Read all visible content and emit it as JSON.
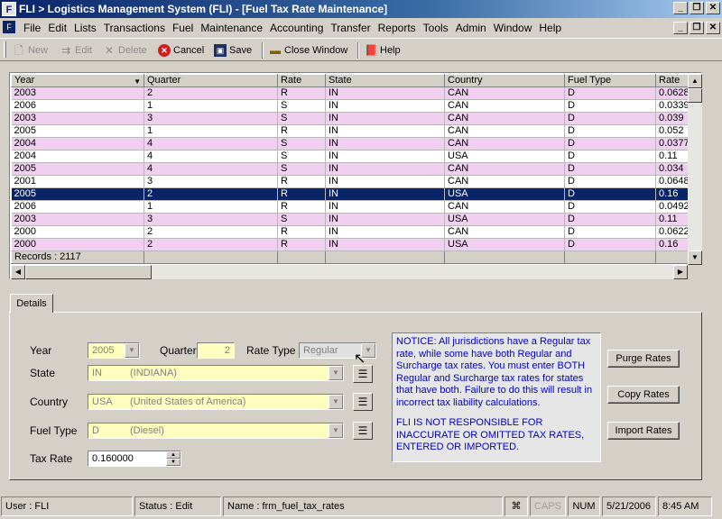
{
  "window": {
    "title": "FLI > Logistics Management System (FLI) - [Fuel Tax Rate Maintenance]",
    "app_icon": "FLI-logo"
  },
  "menu": [
    "File",
    "Edit",
    "Lists",
    "Transactions",
    "Fuel",
    "Maintenance",
    "Accounting",
    "Transfer",
    "Reports",
    "Tools",
    "Admin",
    "Window",
    "Help"
  ],
  "toolbar": {
    "new_label": "New",
    "edit_label": "Edit",
    "delete_label": "Delete",
    "cancel_label": "Cancel",
    "save_label": "Save",
    "close_label": "Close Window",
    "help_label": "Help"
  },
  "grid": {
    "columns": [
      "Year",
      "Quarter",
      "Rate",
      "State",
      "Country",
      "Fuel Type",
      "Rate"
    ],
    "rows": [
      [
        "2003",
        "2",
        "R",
        "IN",
        "CAN",
        "D",
        "0.0628"
      ],
      [
        "2006",
        "1",
        "S",
        "IN",
        "CAN",
        "D",
        "0.0339"
      ],
      [
        "2003",
        "3",
        "S",
        "IN",
        "CAN",
        "D",
        "0.039"
      ],
      [
        "2005",
        "1",
        "R",
        "IN",
        "CAN",
        "D",
        "0.052"
      ],
      [
        "2004",
        "4",
        "S",
        "IN",
        "CAN",
        "D",
        "0.0377"
      ],
      [
        "2004",
        "4",
        "S",
        "IN",
        "USA",
        "D",
        "0.11"
      ],
      [
        "2005",
        "4",
        "S",
        "IN",
        "CAN",
        "D",
        "0.034"
      ],
      [
        "2001",
        "3",
        "R",
        "IN",
        "CAN",
        "D",
        "0.0648"
      ],
      [
        "2005",
        "2",
        "R",
        "IN",
        "USA",
        "D",
        "0.16"
      ],
      [
        "2006",
        "1",
        "R",
        "IN",
        "CAN",
        "D",
        "0.0492"
      ],
      [
        "2003",
        "3",
        "S",
        "IN",
        "USA",
        "D",
        "0.11"
      ],
      [
        "2000",
        "2",
        "R",
        "IN",
        "CAN",
        "D",
        "0.0622"
      ],
      [
        "2000",
        "2",
        "R",
        "IN",
        "USA",
        "D",
        "0.16"
      ]
    ],
    "row_styles": [
      "pink",
      "white",
      "pink",
      "white",
      "pink",
      "white",
      "pink",
      "white",
      "selected",
      "white",
      "pink",
      "white",
      "pink"
    ],
    "records_label": "Records : 2117"
  },
  "details": {
    "tab_label": "Details",
    "year_label": "Year",
    "year_value": "2005",
    "quarter_label": "Quarter",
    "quarter_value": "2",
    "rate_type_label": "Rate Type",
    "rate_type_value": "Regular",
    "state_label": "State",
    "state_code": "IN",
    "state_name": "(INDIANA)",
    "country_label": "Country",
    "country_code": "USA",
    "country_name": "(United States of America)",
    "fuel_type_label": "Fuel Type",
    "fuel_code": "D",
    "fuel_name": "(Diesel)",
    "tax_rate_label": "Tax Rate",
    "tax_rate_value": "0.160000",
    "notice_1": "NOTICE: All jurisdictions have a Regular tax rate, while some have both Regular and Surcharge tax rates.  You must enter BOTH Regular and Surcharge tax rates for states that have both.  Failure to do this will result in incorrect tax liability calculations.",
    "notice_2": "FLI IS NOT RESPONSIBLE FOR INACCURATE OR OMITTED TAX RATES, ENTERED OR IMPORTED.",
    "purge_label": "Purge Rates",
    "copy_label": "Copy Rates",
    "import_label": "Import Rates"
  },
  "status": {
    "user": "User : FLI",
    "status": "Status : Edit",
    "name": "Name : frm_fuel_tax_rates",
    "caps": "CAPS",
    "num": "NUM",
    "date": "5/21/2006",
    "time": "8:45 AM"
  },
  "colors": {
    "title_start": "#0a246a",
    "row_pink": "#f0cff0",
    "row_selected": "#0a246a",
    "field_yellow": "#ffffc0",
    "notice_text": "#0000c8"
  }
}
